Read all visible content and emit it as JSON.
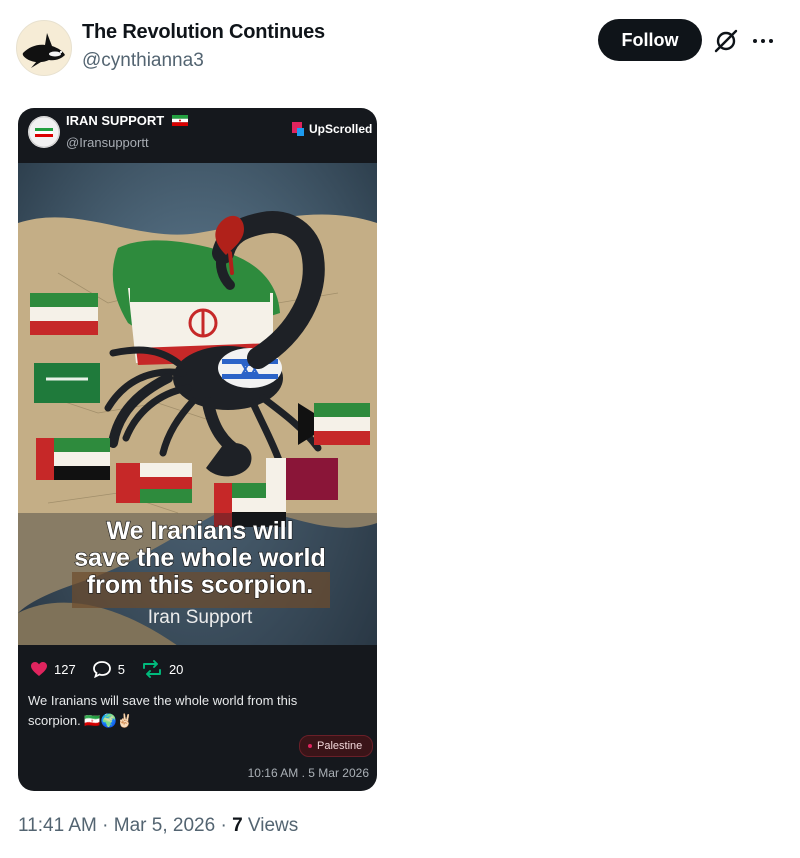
{
  "user": {
    "display_name": "The Revolution Continues",
    "handle": "@cynthianna3",
    "avatar_icon": "orca-icon"
  },
  "actions": {
    "follow_label": "Follow",
    "grok_icon": "grok-icon",
    "more_icon": "more-horizontal-icon"
  },
  "card": {
    "account_name": "IRAN SUPPORT",
    "account_handle": "@Iransupportt",
    "brand": "UpScrolled",
    "image": {
      "headline_lines": [
        "We Iranians will",
        "save the whole world",
        "from this scorpion."
      ],
      "byline": "Iran Support"
    },
    "stats": {
      "likes": "127",
      "comments": "5",
      "reposts": "20"
    },
    "text": "We Iranians will save the whole world from this scorpion. 🇮🇷🌍✌🏻",
    "tag": "Palestine",
    "timestamp": "10:16 AM . 5 Mar 2026",
    "accent_color": "#e0245e",
    "repost_color": "#00ba7c"
  },
  "footer": {
    "time": "11:41 AM",
    "separator": "·",
    "date": "Mar 5, 2026",
    "views_count": "7",
    "views_label": "Views"
  }
}
